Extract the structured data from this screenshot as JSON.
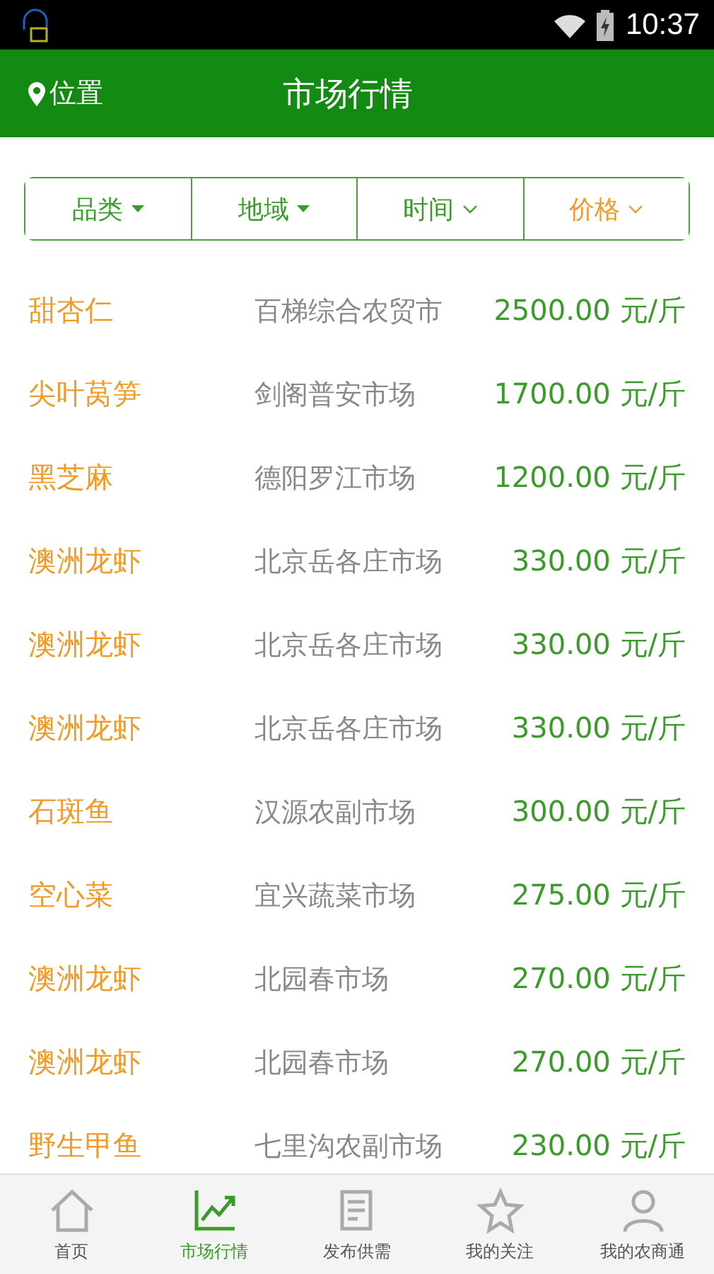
{
  "status_bar": {
    "time": "10:37"
  },
  "header": {
    "location": "位置",
    "title": "市场行情"
  },
  "filters": [
    {
      "label": "品类",
      "kind": "triangle",
      "selected": false
    },
    {
      "label": "地域",
      "kind": "triangle",
      "selected": false
    },
    {
      "label": "时间",
      "kind": "chevron",
      "selected": false
    },
    {
      "label": "价格",
      "kind": "chevron",
      "selected": true
    }
  ],
  "rows": [
    {
      "product": "甜杏仁",
      "market": "百梯综合农贸市",
      "price": "2500.00 元/斤"
    },
    {
      "product": "尖叶莴笋",
      "market": "剑阁普安市场",
      "price": "1700.00 元/斤"
    },
    {
      "product": "黑芝麻",
      "market": "德阳罗江市场",
      "price": "1200.00 元/斤"
    },
    {
      "product": "澳洲龙虾",
      "market": "北京岳各庄市场",
      "price": "330.00 元/斤"
    },
    {
      "product": "澳洲龙虾",
      "market": "北京岳各庄市场",
      "price": "330.00 元/斤"
    },
    {
      "product": "澳洲龙虾",
      "market": "北京岳各庄市场",
      "price": "330.00 元/斤"
    },
    {
      "product": "石斑鱼",
      "market": "汉源农副市场",
      "price": "300.00 元/斤"
    },
    {
      "product": "空心菜",
      "market": "宜兴蔬菜市场",
      "price": "275.00 元/斤"
    },
    {
      "product": "澳洲龙虾",
      "market": "北园春市场",
      "price": "270.00 元/斤"
    },
    {
      "product": "澳洲龙虾",
      "market": "北园春市场",
      "price": "270.00 元/斤"
    },
    {
      "product": "野生甲鱼",
      "market": "七里沟农副市场",
      "price": "230.00 元/斤"
    }
  ],
  "nav": [
    {
      "label": "首页",
      "kind": "home",
      "selected": false
    },
    {
      "label": "市场行情",
      "kind": "chart",
      "selected": true
    },
    {
      "label": "发布供需",
      "kind": "edit",
      "selected": false
    },
    {
      "label": "我的关注",
      "kind": "star",
      "selected": false
    },
    {
      "label": "我的农商通",
      "kind": "user",
      "selected": false
    }
  ]
}
